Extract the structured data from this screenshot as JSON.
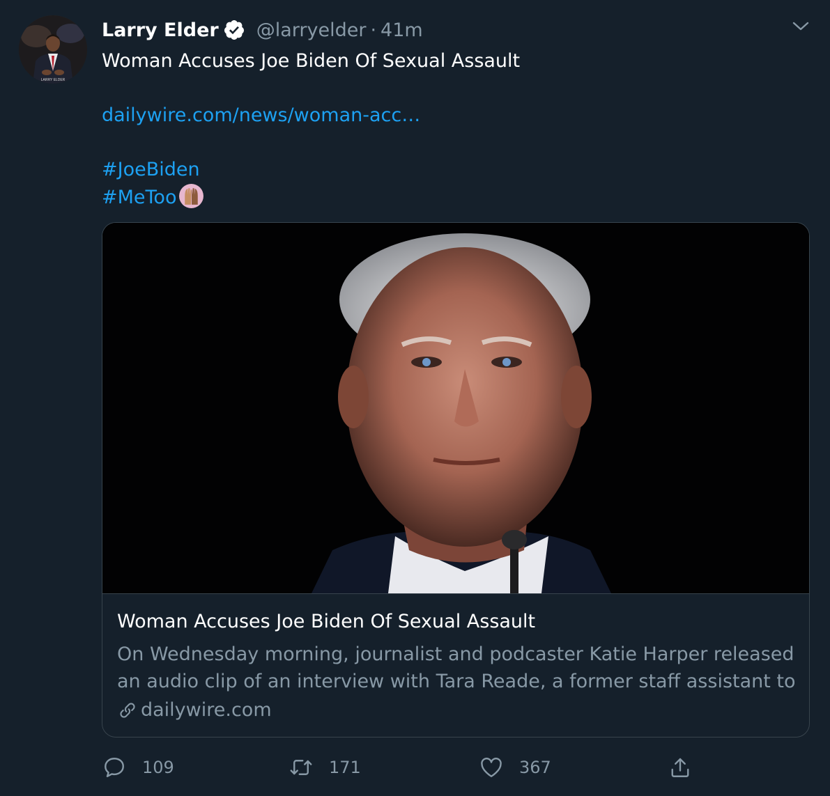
{
  "author": {
    "display_name": "Larry Elder",
    "handle": "@larryelder",
    "separator": "·",
    "timestamp": "41m",
    "verified": true,
    "avatar_caption": "LARRY ELDER"
  },
  "tweet": {
    "text": "Woman Accuses Joe Biden Of Sexual Assault",
    "link": "dailywire.com/news/woman-acc…",
    "hashtag_1": "#JoeBiden",
    "hashtag_2": "#MeToo",
    "emoji": "raised-hands-emoji"
  },
  "card": {
    "image": "portrait-photo",
    "title": "Woman Accuses Joe Biden Of Sexual Assault",
    "description_line_1": "On Wednesday morning, journalist and podcaster Katie Harper released",
    "description_line_2": "an audio clip of an interview with Tara Reade, a former staff assistant to …",
    "domain": "dailywire.com",
    "domain_icon": "link-icon"
  },
  "actions": {
    "reply_count": "109",
    "retweet_count": "171",
    "like_count": "367",
    "reply_icon": "reply-icon",
    "retweet_icon": "retweet-icon",
    "like_icon": "heart-icon",
    "share_icon": "share-icon"
  },
  "colors": {
    "background": "#15202b",
    "link": "#1da1f2",
    "secondary_text": "#8899a6",
    "border": "#38444d"
  }
}
